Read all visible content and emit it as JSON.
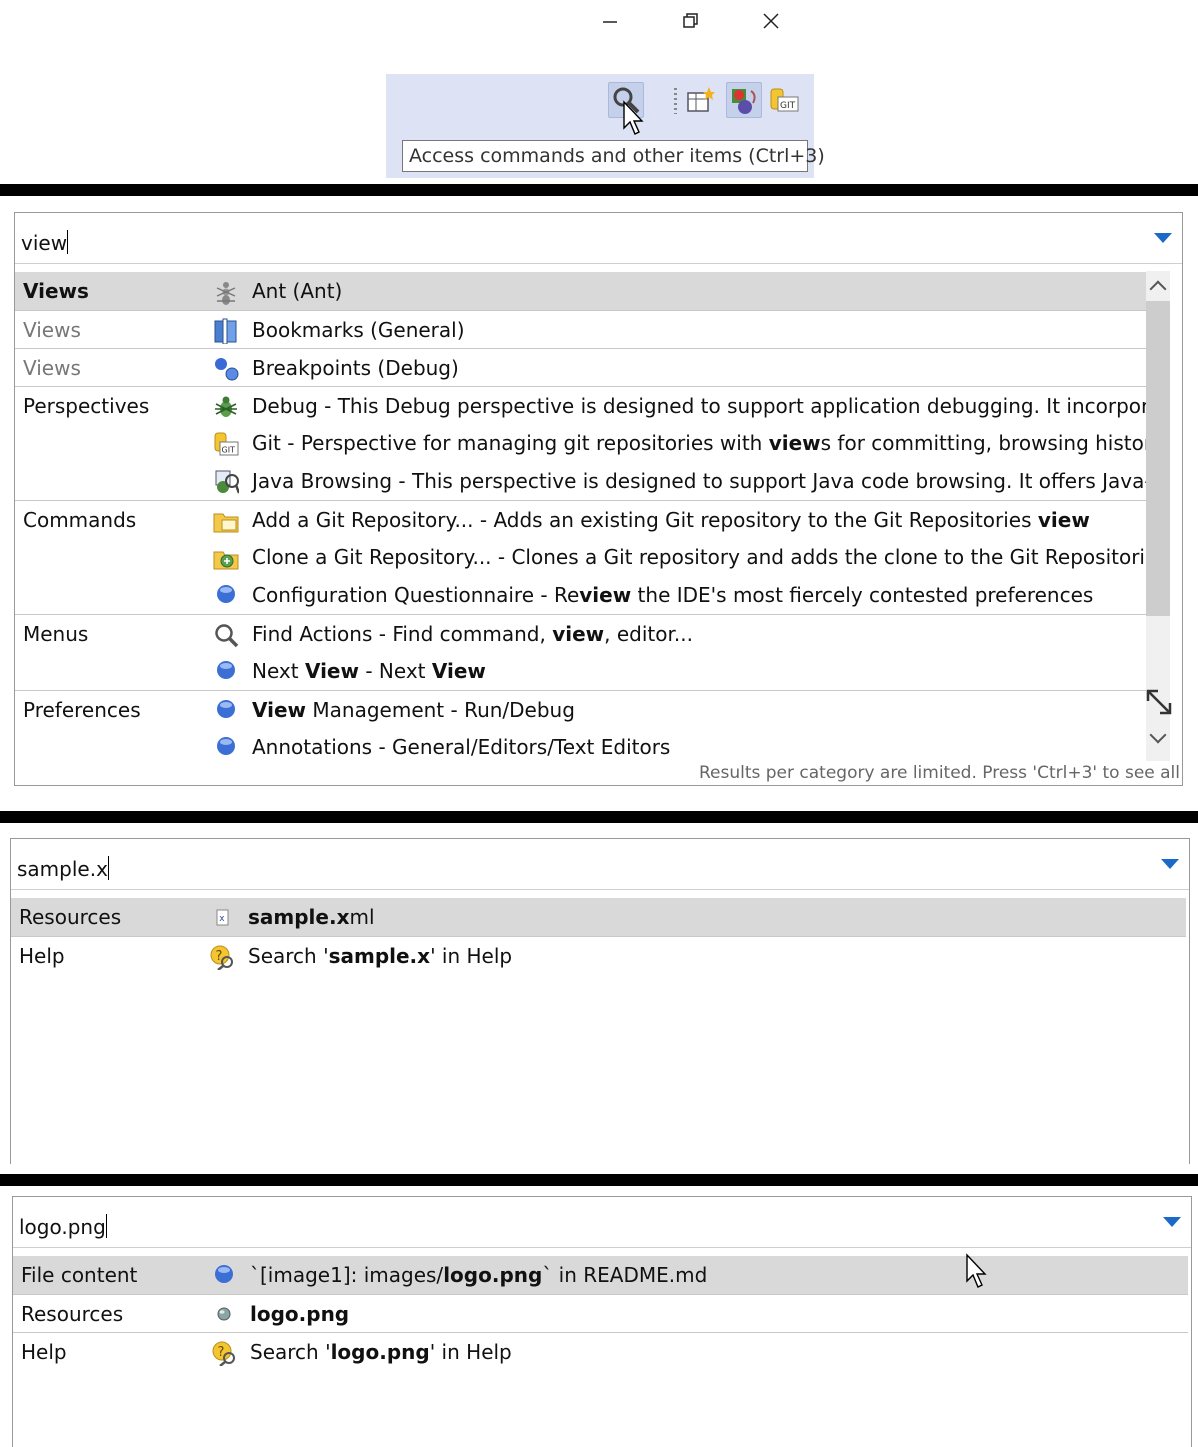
{
  "window": {
    "minimize_icon": "minimize-icon",
    "restore_icon": "restore-icon",
    "close_icon": "close-icon"
  },
  "toolbar": {
    "search_icon": "search-icon",
    "perspective_open_icon": "open-perspective-icon",
    "java_perspective_icon": "java-perspective-icon",
    "git_perspective_icon": "git-perspective-icon",
    "tooltip": "Access commands and other items (Ctrl+3)"
  },
  "panel1": {
    "filter_text": "view",
    "footer": "Results per category are limited. Press 'Ctrl+3' to see all",
    "rows": [
      {
        "category": "Views",
        "icon": "ant-icon",
        "text": "Ant (Ant)"
      },
      {
        "category": "Views",
        "icon": "bookmarks-icon",
        "text": "Bookmarks (General)"
      },
      {
        "category": "Views",
        "icon": "breakpoints-icon",
        "text": "Breakpoints (Debug)"
      },
      {
        "category": "Perspectives",
        "icon": "debug-bug-icon",
        "text": "Debug - This Debug perspective is designed to support application debugging. It incorporates vi"
      },
      {
        "category": "",
        "icon": "git-icon",
        "text": "Git - Perspective for managing git repositories with views for committing, browsing history, intera"
      },
      {
        "category": "",
        "icon": "java-browsing-icon",
        "text": "Java Browsing - This perspective is designed to support Java code browsing. It offers Java-specifi"
      },
      {
        "category": "Commands",
        "icon": "folder-git-icon",
        "text": "Add a Git Repository... - Adds an existing Git repository to the Git Repositories view"
      },
      {
        "category": "",
        "icon": "clone-git-icon",
        "text": "Clone a Git Repository... - Clones a Git repository and adds the clone to the Git Repositories view"
      },
      {
        "category": "",
        "icon": "blue-circle-icon",
        "text": "Configuration Questionnaire - Review the IDE's most fiercely contested preferences"
      },
      {
        "category": "Menus",
        "icon": "magnifier-icon",
        "text": "Find Actions - Find command, view, editor..."
      },
      {
        "category": "",
        "icon": "blue-circle-icon",
        "text": "Next View - Next View"
      },
      {
        "category": "Preferences",
        "icon": "blue-circle-icon",
        "text": "View Management - Run/Debug"
      },
      {
        "category": "",
        "icon": "blue-circle-icon",
        "text": "Annotations - General/Editors/Text Editors"
      }
    ]
  },
  "panel2": {
    "filter_text": "sample.x",
    "rows": [
      {
        "category": "Resources",
        "icon": "xml-file-icon",
        "text": "sample.xml"
      },
      {
        "category": "Help",
        "icon": "help-search-icon",
        "text": "Search 'sample.x' in Help"
      }
    ]
  },
  "panel3": {
    "filter_text": "logo.png",
    "rows": [
      {
        "category": "File content",
        "icon": "blue-circle-icon",
        "text": "`[image1]: images/logo.png` in README.md"
      },
      {
        "category": "Resources",
        "icon": "png-file-icon",
        "text": "logo.png"
      },
      {
        "category": "Help",
        "icon": "help-search-icon",
        "text": "Search 'logo.png' in Help"
      }
    ]
  },
  "colors": {
    "selection": "#d9d9d9",
    "accent": "#1b6ac9",
    "toolbar_bg": "#dde3f5"
  }
}
